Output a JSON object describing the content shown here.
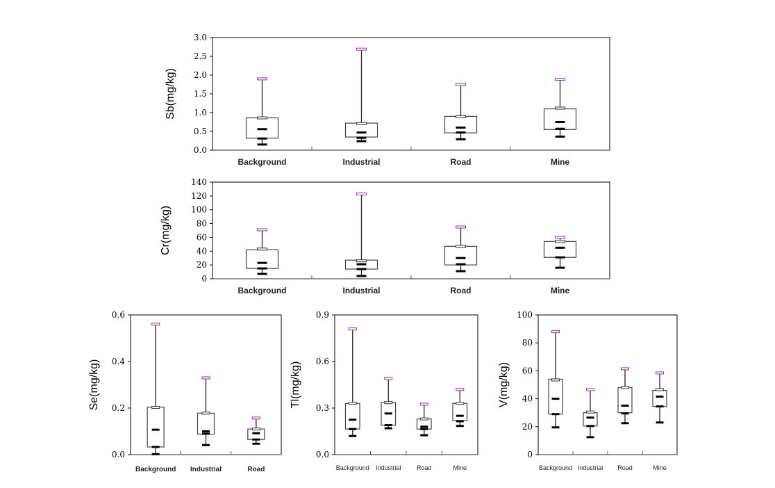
{
  "chart_data": [
    {
      "type": "boxplot",
      "id": "sb",
      "title": "",
      "ylabel": "Sb(mg/kg)",
      "xlabel": "",
      "ylim": [
        0,
        3.0
      ],
      "yticks": [
        0.0,
        0.5,
        1.0,
        1.5,
        2.0,
        2.5,
        3.0
      ],
      "ytick_labels": [
        "0.0",
        "0.5",
        "1.0",
        "1.5",
        "2.0",
        "2.5",
        "3.0"
      ],
      "categories": [
        "Background",
        "Industrial",
        "Road",
        "Mine"
      ],
      "boxes": [
        {
          "min": 0.15,
          "p10": 0.31,
          "q1": 0.32,
          "median": 0.56,
          "q3": 0.86,
          "p90": 0.86,
          "max": 1.9
        },
        {
          "min": 0.24,
          "p10": 0.33,
          "q1": 0.35,
          "median": 0.47,
          "q3": 0.72,
          "p90": 0.71,
          "max": 2.69
        },
        {
          "min": 0.29,
          "p10": 0.47,
          "q1": 0.46,
          "median": 0.6,
          "q3": 0.9,
          "p90": 0.89,
          "max": 1.75
        },
        {
          "min": 0.36,
          "p10": 0.57,
          "q1": 0.55,
          "median": 0.75,
          "q3": 1.1,
          "p90": 1.12,
          "max": 1.89
        }
      ]
    },
    {
      "type": "boxplot",
      "id": "cr",
      "title": "",
      "ylabel": "Cr(mg/kg)",
      "xlabel": "",
      "ylim": [
        0,
        140
      ],
      "yticks": [
        0,
        20,
        40,
        60,
        80,
        100,
        120,
        140
      ],
      "ytick_labels": [
        "0",
        "20",
        "40",
        "60",
        "80",
        "100",
        "120",
        "140"
      ],
      "categories": [
        "Background",
        "Industrial",
        "Road",
        "Mine"
      ],
      "boxes": [
        {
          "min": 7,
          "p10": 15,
          "q1": 15,
          "median": 23,
          "q3": 42,
          "p90": 43,
          "max": 71
        },
        {
          "min": 4,
          "p10": 14,
          "q1": 14,
          "median": 21,
          "q3": 27,
          "p90": 26,
          "max": 123
        },
        {
          "min": 11,
          "p10": 21,
          "q1": 20,
          "median": 30,
          "q3": 47,
          "p90": 47,
          "max": 75
        },
        {
          "min": 16,
          "p10": 31,
          "q1": 31,
          "median": 45,
          "q3": 54,
          "p90": 54,
          "max": 60
        }
      ]
    },
    {
      "type": "boxplot",
      "id": "se",
      "title": "",
      "ylabel": "Se(mg/kg)",
      "xlabel": "",
      "ylim": [
        0,
        0.6
      ],
      "yticks": [
        0.0,
        0.2,
        0.4,
        0.6
      ],
      "ytick_labels": [
        "0.0",
        "0.2",
        "0.4",
        "0.6"
      ],
      "categories": [
        "Background",
        "Industrial",
        "Road"
      ],
      "boxes": [
        {
          "min": 0.002,
          "p10": 0.033,
          "q1": 0.033,
          "median": 0.107,
          "q3": 0.204,
          "p90": 0.203,
          "max": 0.56
        },
        {
          "min": 0.041,
          "p10": 0.09,
          "q1": 0.088,
          "median": 0.1,
          "q3": 0.178,
          "p90": 0.178,
          "max": 0.33
        },
        {
          "min": 0.047,
          "p10": 0.065,
          "q1": 0.065,
          "median": 0.092,
          "q3": 0.11,
          "p90": 0.11,
          "max": 0.157
        }
      ]
    },
    {
      "type": "boxplot",
      "id": "tl",
      "title": "",
      "ylabel": "Tl(mg/kg)",
      "xlabel": "",
      "ylim": [
        0,
        0.9
      ],
      "yticks": [
        0.0,
        0.3,
        0.6,
        0.9
      ],
      "ytick_labels": [
        "0.0",
        "0.3",
        "0.6",
        "0.9"
      ],
      "categories": [
        "Background",
        "Industrial",
        "Road",
        "Mine"
      ],
      "boxes": [
        {
          "min": 0.12,
          "p10": 0.165,
          "q1": 0.165,
          "median": 0.225,
          "q3": 0.33,
          "p90": 0.33,
          "max": 0.81
        },
        {
          "min": 0.17,
          "p10": 0.19,
          "q1": 0.19,
          "median": 0.265,
          "q3": 0.335,
          "p90": 0.335,
          "max": 0.49
        },
        {
          "min": 0.125,
          "p10": 0.165,
          "q1": 0.165,
          "median": 0.18,
          "q3": 0.23,
          "p90": 0.23,
          "max": 0.325
        },
        {
          "min": 0.185,
          "p10": 0.215,
          "q1": 0.22,
          "median": 0.25,
          "q3": 0.33,
          "p90": 0.33,
          "max": 0.42
        }
      ]
    },
    {
      "type": "boxplot",
      "id": "v",
      "title": "",
      "ylabel": "V(mg/kg)",
      "xlabel": "",
      "ylim": [
        0,
        100
      ],
      "yticks": [
        0,
        20,
        40,
        60,
        80,
        100
      ],
      "ytick_labels": [
        "0",
        "20",
        "40",
        "60",
        "80",
        "100"
      ],
      "categories": [
        "Background",
        "Industrial",
        "Road",
        "Mine"
      ],
      "boxes": [
        {
          "min": 19.5,
          "p10": 29,
          "q1": 29,
          "median": 40,
          "q3": 54,
          "p90": 53.5,
          "max": 88
        },
        {
          "min": 12.5,
          "p10": 20.5,
          "q1": 20.5,
          "median": 26.5,
          "q3": 30,
          "p90": 30.5,
          "max": 46.5
        },
        {
          "min": 22.5,
          "p10": 29.5,
          "q1": 30,
          "median": 35,
          "q3": 48,
          "p90": 48,
          "max": 61.5
        },
        {
          "min": 23,
          "p10": 34.5,
          "q1": 34.5,
          "median": 41.5,
          "q3": 46,
          "p90": 46.5,
          "max": 58.5
        }
      ]
    }
  ],
  "colors": {
    "axis": "#000000",
    "box": "#444444",
    "whisker": "#222222",
    "max_cap": "#9933aa",
    "marker": "#000000"
  }
}
